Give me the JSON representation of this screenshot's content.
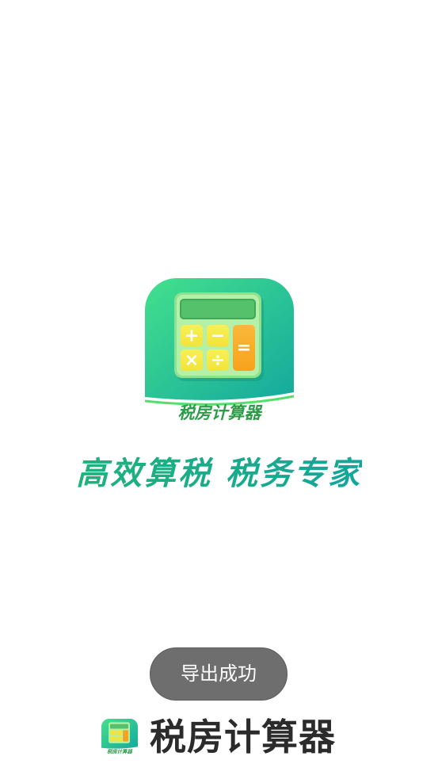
{
  "logo": {
    "caption": "税房计算器",
    "keys": {
      "plus": "+",
      "minus": "−",
      "equals": "=",
      "times": "×",
      "divide": "÷"
    }
  },
  "slogan": "高效算税 税务专家",
  "toast": {
    "message": "导出成功"
  },
  "footer": {
    "app_name": "税房计算器",
    "icon_caption": "税房计算器"
  },
  "icons": {
    "app_logo": "calculator-icon",
    "footer_logo": "calculator-icon"
  },
  "colors": {
    "logo_gradient_start": "#43e08c",
    "logo_gradient_end": "#15a99e",
    "slogan_gradient_start": "#1fb27a",
    "slogan_gradient_end": "#15a59b",
    "logo_caption": "#2c9c49",
    "key_yellow": "#f2e33b",
    "key_orange": "#f7a21d",
    "toast_background": "#6e6e6e",
    "footer_text": "#2b2b2b",
    "background": "#ffffff"
  }
}
